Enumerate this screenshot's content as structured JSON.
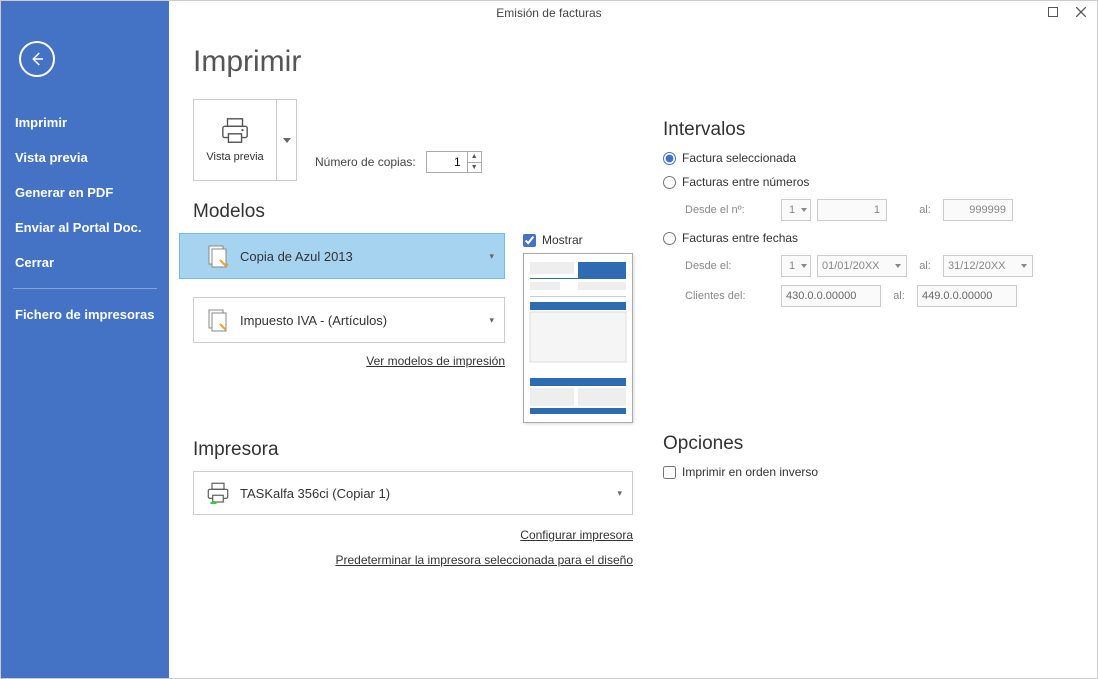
{
  "window": {
    "title": "Emisión de facturas"
  },
  "sidebar": {
    "items": [
      "Imprimir",
      "Vista previa",
      "Generar en PDF",
      "Enviar al Portal Doc.",
      "Cerrar"
    ],
    "footer": "Fichero de impresoras"
  },
  "page": {
    "title": "Imprimir"
  },
  "preview_button": {
    "label": "Vista previa"
  },
  "copies": {
    "label": "Número de copias:",
    "value": "1"
  },
  "models": {
    "heading": "Modelos",
    "show_label": "Mostrar",
    "item_selected": "Copia de Azul 2013",
    "item_2": "Impuesto IVA - (Artículos)",
    "view_link": "Ver modelos de impresión"
  },
  "printer": {
    "heading": "Impresora",
    "name": "TASKalfa 356ci (Copiar 1)",
    "config_link": "Configurar impresora",
    "default_link": "Predeterminar la impresora seleccionada para el diseño"
  },
  "intervalos": {
    "heading": "Intervalos",
    "opt_sel": "Factura seleccionada",
    "opt_nums": "Facturas entre números",
    "desde_num": "Desde el nº:",
    "num_drop": "1",
    "num_from": "1",
    "num_to": "999999",
    "al": "al:",
    "opt_fechas": "Facturas entre fechas",
    "desde_el": "Desde el:",
    "date_drop": "1",
    "date_from": "01/01/20XX",
    "date_to": "31/12/20XX",
    "clientes": "Clientes del:",
    "cli_from": "430.0.0.00000",
    "cli_to": "449.0.0.00000"
  },
  "opciones": {
    "heading": "Opciones",
    "reverse": "Imprimir en orden inverso"
  }
}
